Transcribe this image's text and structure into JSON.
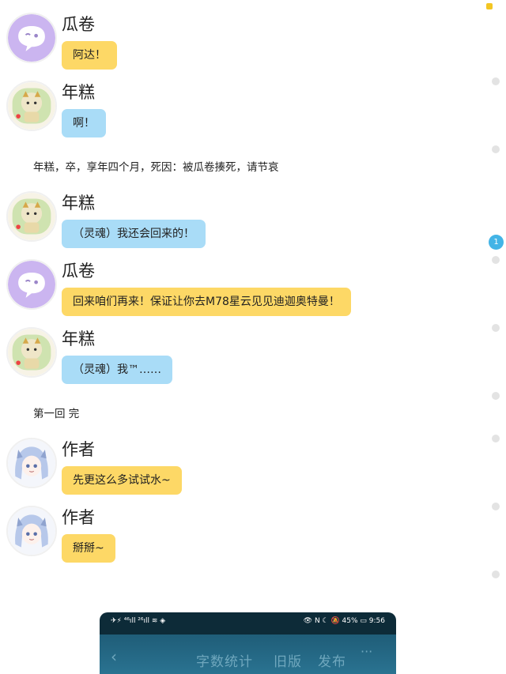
{
  "messages": [
    {
      "name": "瓜卷",
      "text": "阿达！"
    },
    {
      "name": "年糕",
      "text": "啊！"
    },
    {
      "name": "年糕",
      "text": "（灵魂）我还会回来的！"
    },
    {
      "name": "瓜卷",
      "text": "回来咱们再来！保证让你去M78星云见见迪迦奥特曼！"
    },
    {
      "name": "年糕",
      "text": "（灵魂）我™……"
    },
    {
      "name": "作者",
      "text": "先更这么多试试水~"
    },
    {
      "name": "作者",
      "text": "掰掰~"
    }
  ],
  "narrations": [
    "年糕，卒，享年四个月，死因：被瓜卷揍死，请节哀",
    "第一回 完"
  ],
  "sidebar": {
    "badge": "1"
  },
  "phone": {
    "status_left": "✈⚡ ⁴⁶ıll ²⁶ıll ≋ ◈",
    "status_right": "👁 N ☾ 🔕 45% ▭ 9:56",
    "back_icon": "‹",
    "word_count": "字数统计",
    "old_version": "旧版",
    "publish": "发布",
    "more": "···"
  },
  "colors": {
    "yellow_bubble": "#fdd866",
    "blue_bubble": "#a9dcf7",
    "badge": "#43b4e6"
  }
}
